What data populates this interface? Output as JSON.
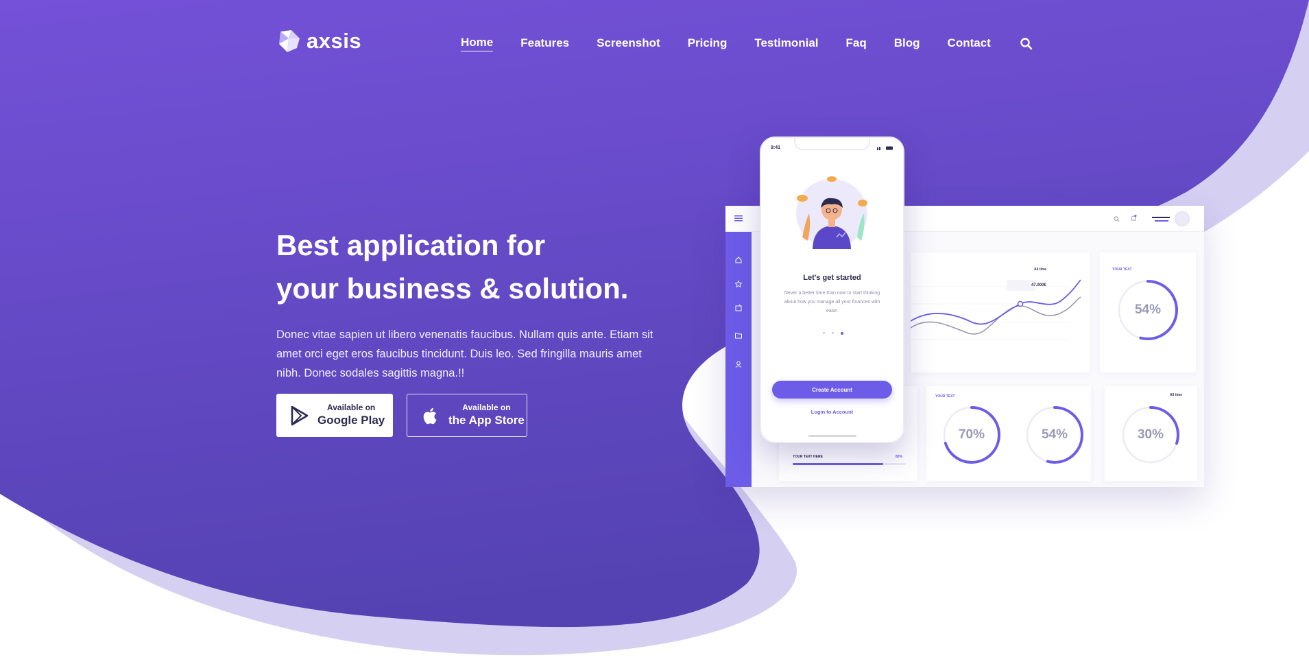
{
  "brand": {
    "name": "axsis"
  },
  "nav": {
    "items": [
      {
        "label": "Home",
        "active": true
      },
      {
        "label": "Features"
      },
      {
        "label": "Screenshot"
      },
      {
        "label": "Pricing"
      },
      {
        "label": "Testimonial"
      },
      {
        "label": "Faq"
      },
      {
        "label": "Blog"
      },
      {
        "label": "Contact"
      }
    ],
    "search_icon": "search-icon"
  },
  "hero": {
    "title_line1": "Best application for",
    "title_line2": "your business & solution.",
    "description": "Donec vitae sapien ut libero venenatis faucibus. Nullam quis ante. Etiam sit amet orci eget eros faucibus tincidunt. Duis leo. Sed fringilla mauris amet nibh. Donec sodales sagittis magna.!!"
  },
  "stores": {
    "google": {
      "small": "Available on",
      "large": "Google Play",
      "icon": "google-play-icon"
    },
    "apple": {
      "small": "Available on",
      "large": "the App Store",
      "icon": "apple-icon"
    }
  },
  "phone": {
    "time": "9:41",
    "title": "Let's get started",
    "description": "Never a better time than now to start thinking about how you manage all your finances with ease.",
    "cta": "Create Account",
    "login": "Login to Account"
  },
  "dashboard": {
    "tooltip_value": "47.000€",
    "filter_label": "All time",
    "progress_label": "YOUR TEXT HERE",
    "progress_value": "80%",
    "progress_fraction": 0.8,
    "card_label": "YOUR TEXT",
    "rings": [
      {
        "label": "54%",
        "value": 0.54
      },
      {
        "label": "70%",
        "value": 0.7
      },
      {
        "label": "54%",
        "value": 0.54
      },
      {
        "label": "30%",
        "value": 0.3
      }
    ],
    "colors": {
      "accent": "#6c5ce7",
      "line2": "#9a98aa"
    }
  },
  "colors": {
    "hero_top": "#6f4bd4",
    "hero_bottom": "#5a45b8",
    "wave_light": "#d5d0f2",
    "accent": "#6c5ce7"
  }
}
